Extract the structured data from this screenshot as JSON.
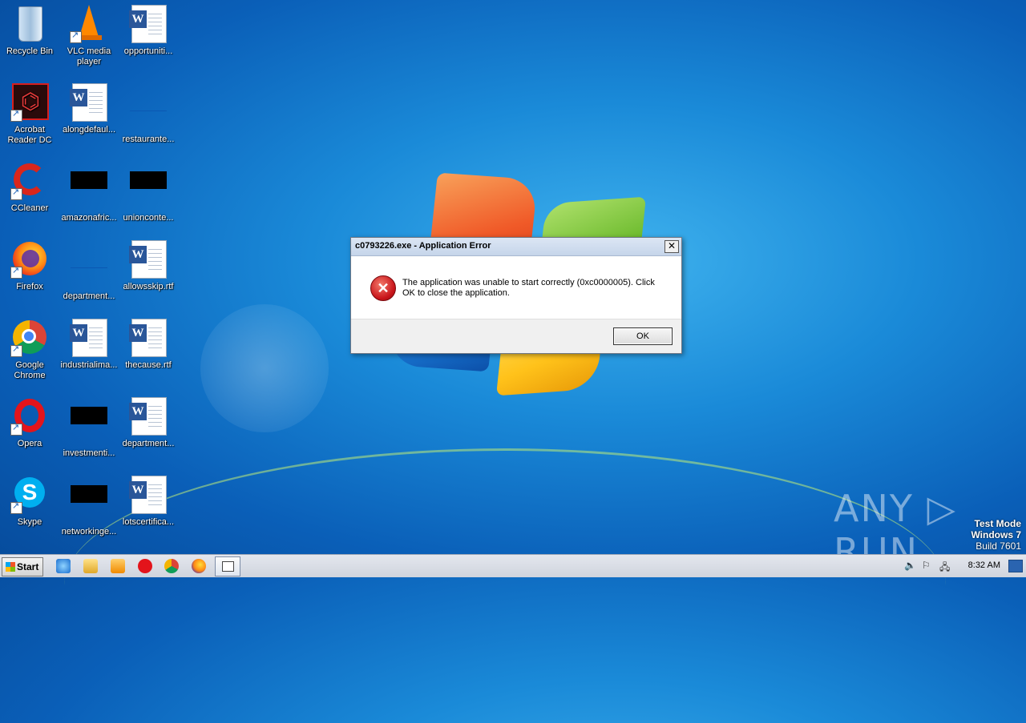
{
  "desktop": {
    "icons": [
      {
        "label": "Recycle Bin"
      },
      {
        "label": "VLC media player"
      },
      {
        "label": "opportuniti..."
      },
      {
        "label": "Acrobat Reader DC"
      },
      {
        "label": "alongdefaul..."
      },
      {
        "label": "restaurante..."
      },
      {
        "label": "CCleaner"
      },
      {
        "label": "amazonafric..."
      },
      {
        "label": "unionconte..."
      },
      {
        "label": "Firefox"
      },
      {
        "label": "department..."
      },
      {
        "label": "allowsskip.rtf"
      },
      {
        "label": "Google Chrome"
      },
      {
        "label": "industrialima..."
      },
      {
        "label": "thecause.rtf"
      },
      {
        "label": "Opera"
      },
      {
        "label": "investmenti..."
      },
      {
        "label": "department..."
      },
      {
        "label": "Skype"
      },
      {
        "label": "networkinge..."
      },
      {
        "label": "lotscertifica..."
      }
    ]
  },
  "dialog": {
    "title": "c0793226.exe - Application Error",
    "close_label": "✕",
    "message": "The application was unable to start correctly (0xc0000005). Click OK to close the application.",
    "ok_label": "OK"
  },
  "watermark": {
    "text": "ANY ▷ RUN",
    "test_mode": "Test Mode",
    "os": "Windows 7",
    "build": "Build 7601"
  },
  "taskbar": {
    "start_label": "Start",
    "clock": "8:32 AM",
    "tray": {
      "volume_icon": "🔈",
      "flag_icon": "⚐",
      "network_icon": "🖧"
    }
  },
  "colors": {
    "error_red": "#c8141a",
    "desktop_blue": "#1a8ad8"
  }
}
